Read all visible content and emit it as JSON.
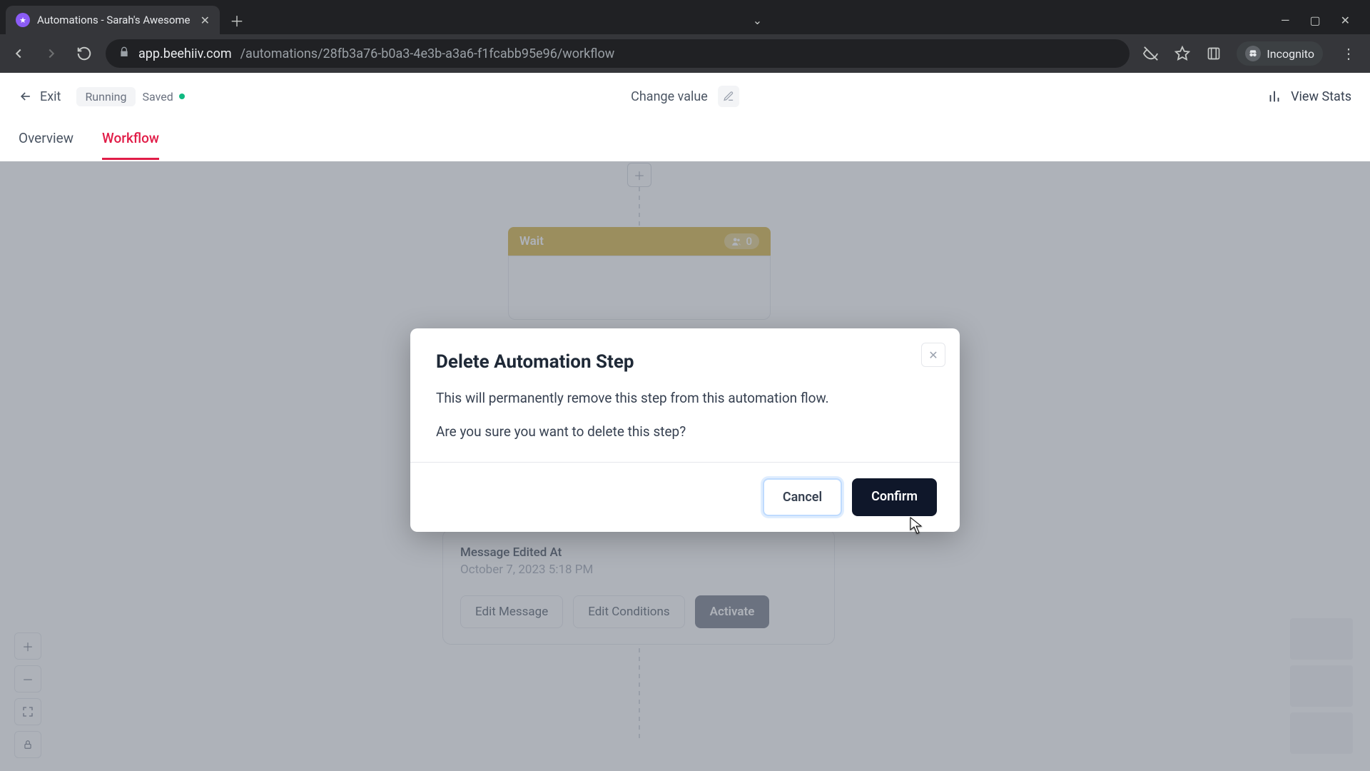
{
  "browser": {
    "tab_title": "Automations - Sarah's Awesome",
    "url_host": "app.beehiiv.com",
    "url_path": "/automations/28fb3a76-b0a3-4e3b-a3a6-f1fcabb95e96/workflow",
    "incognito_label": "Incognito"
  },
  "header": {
    "exit_label": "Exit",
    "status_running": "Running",
    "status_saved": "Saved",
    "title": "Change value",
    "view_stats_label": "View Stats"
  },
  "tabs": {
    "overview": "Overview",
    "workflow": "Workflow"
  },
  "workflow": {
    "wait_label": "Wait",
    "wait_count": "0",
    "msg_edited_label": "Message Edited At",
    "msg_edited_date": "October 7, 2023 5:18 PM",
    "edit_message_btn": "Edit Message",
    "edit_conditions_btn": "Edit Conditions",
    "activate_btn": "Activate"
  },
  "modal": {
    "title": "Delete Automation Step",
    "line1": "This will permanently remove this step from this automation flow.",
    "line2": "Are you sure you want to delete this step?",
    "cancel_label": "Cancel",
    "confirm_label": "Confirm"
  }
}
